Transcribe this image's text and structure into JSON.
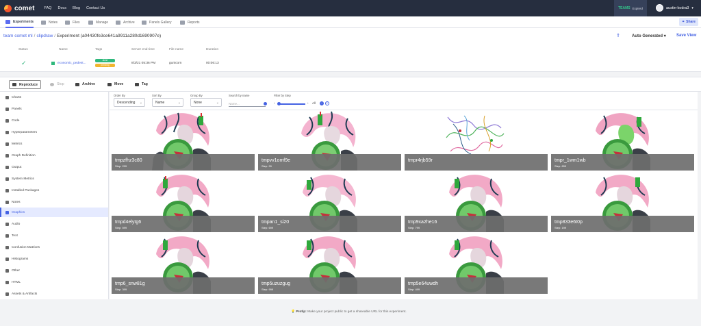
{
  "nav": {
    "brand": "comet",
    "links": [
      "FAQ",
      "Docs",
      "Blog",
      "Contact Us"
    ],
    "teams_label": "TEAMS",
    "teams_status": "Expired",
    "username": "austin-kodra3"
  },
  "tabs": [
    "Experiments",
    "Notes",
    "Files",
    "Manage",
    "Archive",
    "Panels Gallery",
    "Reports"
  ],
  "share_label": "Share",
  "breadcrumb": {
    "workspace": "team comet ml",
    "project": "clipdraw",
    "current": "Experiment (a04430fe3ce641a9911a280d1690907e)"
  },
  "view_controls": {
    "auto_generated": "Auto Generated",
    "save_view": "Save View"
  },
  "experiment_table": {
    "headers": [
      "Status",
      "Name",
      "Tags",
      "Server end time",
      "File name",
      "Duration"
    ],
    "row": {
      "name": "economic_pedest...",
      "tags": [
        "done",
        "pending"
      ],
      "server_end_time": "8/3/21 05:36 PM",
      "file_name": "gunicorn",
      "duration": "00:06:13"
    }
  },
  "actions": [
    "Reproduce",
    "Stop",
    "Archive",
    "Move",
    "Tag"
  ],
  "sidebar": {
    "items": [
      "Charts",
      "Panels",
      "Code",
      "Hyperparameters",
      "Metrics",
      "Graph Definition",
      "Output",
      "System Metrics",
      "Installed Packages",
      "Notes",
      "Graphics",
      "Audio",
      "Text",
      "Confusion Matrices",
      "Histograms",
      "Other",
      "HTML",
      "Assets & Artifacts"
    ],
    "active_index": 10
  },
  "filters": {
    "order_by_label": "Order By",
    "order_by_value": "Descending",
    "sort_by_label": "Sort By",
    "sort_by_value": "Name",
    "group_by_label": "Group By",
    "group_by_value": "None",
    "search_label": "Search by name",
    "search_placeholder": "Name...",
    "step_label": "Filter by Step",
    "step_value": "All"
  },
  "images": [
    {
      "name": "tmpzfhz3c80",
      "step": "Step: 299"
    },
    {
      "name": "tmpvv1omf9e",
      "step": "Step: 99"
    },
    {
      "name": "tmpr4rjb59r",
      "step": ""
    },
    {
      "name": "tmpr_1wm1wb",
      "step": "Step: 899"
    },
    {
      "name": "tmpd4elytg6",
      "step": "Step: 599"
    },
    {
      "name": "tmpan1_si20",
      "step": "Step: 699"
    },
    {
      "name": "tmp9xa2he16",
      "step": "Step: 799"
    },
    {
      "name": "tmp833e6t0p",
      "step": "Step: 199"
    },
    {
      "name": "tmp6_snw81g",
      "step": "Step: 399"
    },
    {
      "name": "tmp5uzuzgug",
      "step": "Step: 999"
    },
    {
      "name": "tmp5e64uwdh",
      "step": "Step: 499"
    }
  ],
  "footer": {
    "protip_label": "Protip:",
    "protip_text": "Make your project public to get a shareable URL for this experiment."
  },
  "colors": {
    "accent": "#4462e3",
    "nav_bg": "#262e3f",
    "success": "#2fb87c",
    "warning": "#f1b52e"
  }
}
